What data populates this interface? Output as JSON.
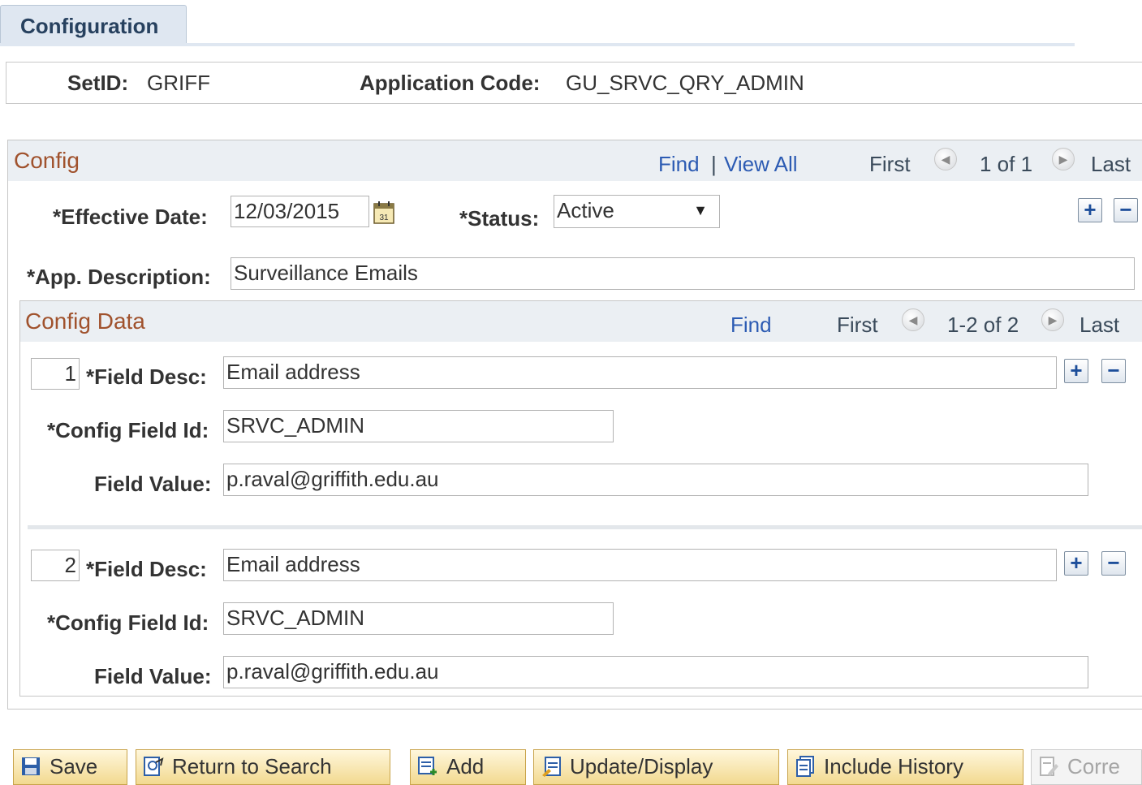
{
  "tabs": [
    {
      "label": "Configuration"
    }
  ],
  "header": {
    "setid_label": "SetID:",
    "setid_value": "GRIFF",
    "appcode_label": "Application Code:",
    "appcode_value": "GU_SRVC_QRY_ADMIN"
  },
  "config": {
    "title": "Config",
    "find": "Find",
    "separator": "|",
    "view_all": "View All",
    "first": "First",
    "counter": "1 of 1",
    "last": "Last",
    "effective_date_label": "*Effective Date:",
    "effective_date_value": "12/03/2015",
    "status_label": "*Status:",
    "status_value": "Active",
    "app_desc_label": "*App. Description:",
    "app_desc_value": "Surveillance Emails"
  },
  "config_data": {
    "title": "Config Data",
    "find": "Find",
    "first": "First",
    "counter": "1-2 of 2",
    "last": "Last",
    "rows": [
      {
        "row_number": "1",
        "field_desc_label": "*Field Desc:",
        "field_desc_value": "Email address",
        "config_field_id_label": "*Config Field Id:",
        "config_field_id_value": "SRVC_ADMIN",
        "field_value_label": "Field Value:",
        "field_value_value": "p.raval@griffith.edu.au"
      },
      {
        "row_number": "2",
        "field_desc_label": "*Field Desc:",
        "field_desc_value": "Email address",
        "config_field_id_label": "*Config Field Id:",
        "config_field_id_value": "SRVC_ADMIN",
        "field_value_label": "Field Value:",
        "field_value_value": "p.raval@griffith.edu.au"
      }
    ]
  },
  "toolbar": {
    "save": "Save",
    "return_to_search": "Return to Search",
    "add": "Add",
    "update_display": "Update/Display",
    "include_history": "Include History",
    "correct_history": "Corre"
  },
  "symbols": {
    "plus": "+",
    "minus": "−",
    "dropdown": "▼",
    "prev": "◀",
    "next": "▶"
  },
  "icons": [
    "calendar-icon",
    "prev-arrow-icon",
    "next-arrow-icon",
    "save-icon",
    "return-to-search-icon",
    "add-icon",
    "update-display-icon",
    "include-history-icon",
    "correct-history-icon"
  ],
  "colors": {
    "link": "#2c5bb3",
    "group_title": "#a0522d",
    "tab_text": "#27415f",
    "button_blue": "#1d4e9a",
    "toolbar_button": "#f2d98f"
  }
}
